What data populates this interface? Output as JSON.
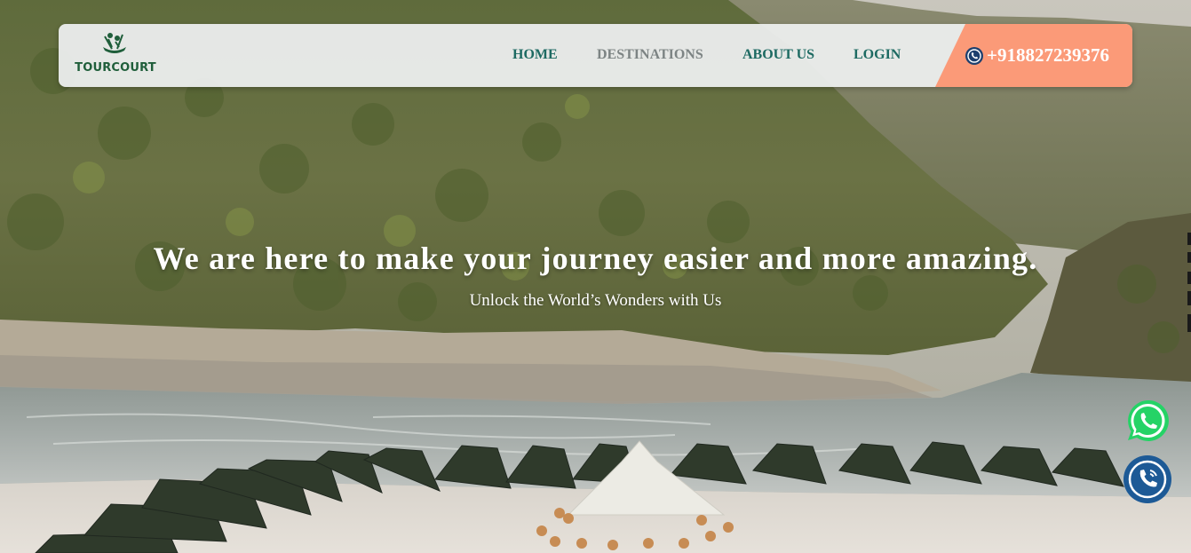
{
  "brand": {
    "name": "TOURCOURT",
    "color": "#1f5e3a"
  },
  "nav": {
    "items": [
      {
        "label": "HOME"
      },
      {
        "label": "DESTINATIONS"
      },
      {
        "label": "ABOUT US"
      },
      {
        "label": "LOGIN"
      }
    ],
    "phone": "+918827239376",
    "phone_icon": "phone-icon",
    "accent_color": "#fb9a78",
    "link_color": "#1d6a62"
  },
  "hero": {
    "headline": "We are here to make your journey easier and more amazing.",
    "subheadline": "Unlock the World’s Wonders with Us"
  },
  "floating_buttons": [
    {
      "icon": "whatsapp-icon",
      "color": "#25d366"
    },
    {
      "icon": "call-icon",
      "color": "#1d5a96"
    }
  ]
}
